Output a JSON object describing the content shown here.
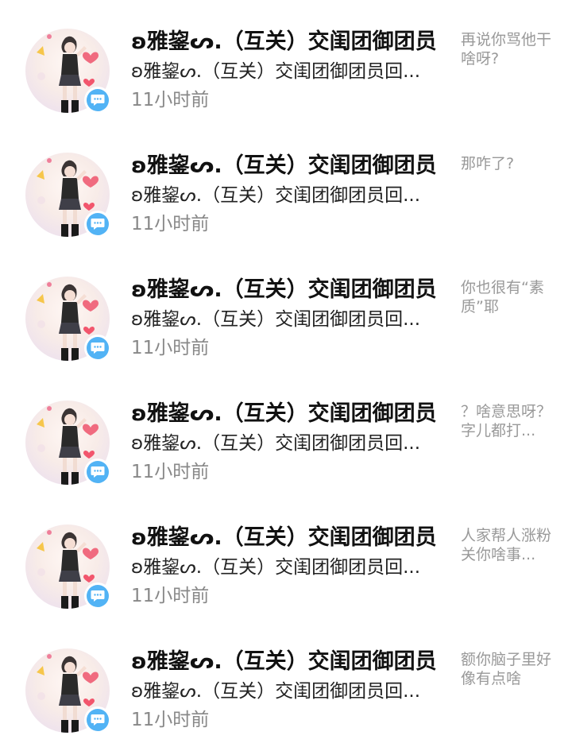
{
  "messages": [
    {
      "name": "ʚ雅鋆ᔕ.（互关）交闺团御团员",
      "subtitle": "ʚ雅鋆ᔕ.（互关）交闺团御团员回...",
      "time": "11小时前",
      "comment": "再说你骂他干啥呀?",
      "badge_icon": "message-bubble-icon"
    },
    {
      "name": "ʚ雅鋆ᔕ.（互关）交闺团御团员",
      "subtitle": "ʚ雅鋆ᔕ.（互关）交闺团御团员回...",
      "time": "11小时前",
      "comment": "那咋了?",
      "badge_icon": "message-bubble-icon"
    },
    {
      "name": "ʚ雅鋆ᔕ.（互关）交闺团御团员",
      "subtitle": "ʚ雅鋆ᔕ.（互关）交闺团御团员回...",
      "time": "11小时前",
      "comment": "你也很有“素质”耶",
      "badge_icon": "message-bubble-icon"
    },
    {
      "name": "ʚ雅鋆ᔕ.（互关）交闺团御团员",
      "subtitle": "ʚ雅鋆ᔕ.（互关）交闺团御团员回...",
      "time": "11小时前",
      "comment": "？啥意思呀？字儿都打...",
      "badge_icon": "message-bubble-icon"
    },
    {
      "name": "ʚ雅鋆ᔕ.（互关）交闺团御团员",
      "subtitle": "ʚ雅鋆ᔕ.（互关）交闺团御团员回...",
      "time": "11小时前",
      "comment": "人家帮人涨粉关你啥事...",
      "badge_icon": "message-bubble-icon"
    },
    {
      "name": "ʚ雅鋆ᔕ.（互关）交闺团御团员",
      "subtitle": "ʚ雅鋆ᔕ.（互关）交闺团御团员回...",
      "time": "11小时前",
      "comment": "额你脑子里好像有点啥",
      "badge_icon": "message-bubble-icon"
    }
  ],
  "colors": {
    "badge": "#52b3f5",
    "name": "#111111",
    "time": "#888888",
    "comment": "#999999"
  }
}
